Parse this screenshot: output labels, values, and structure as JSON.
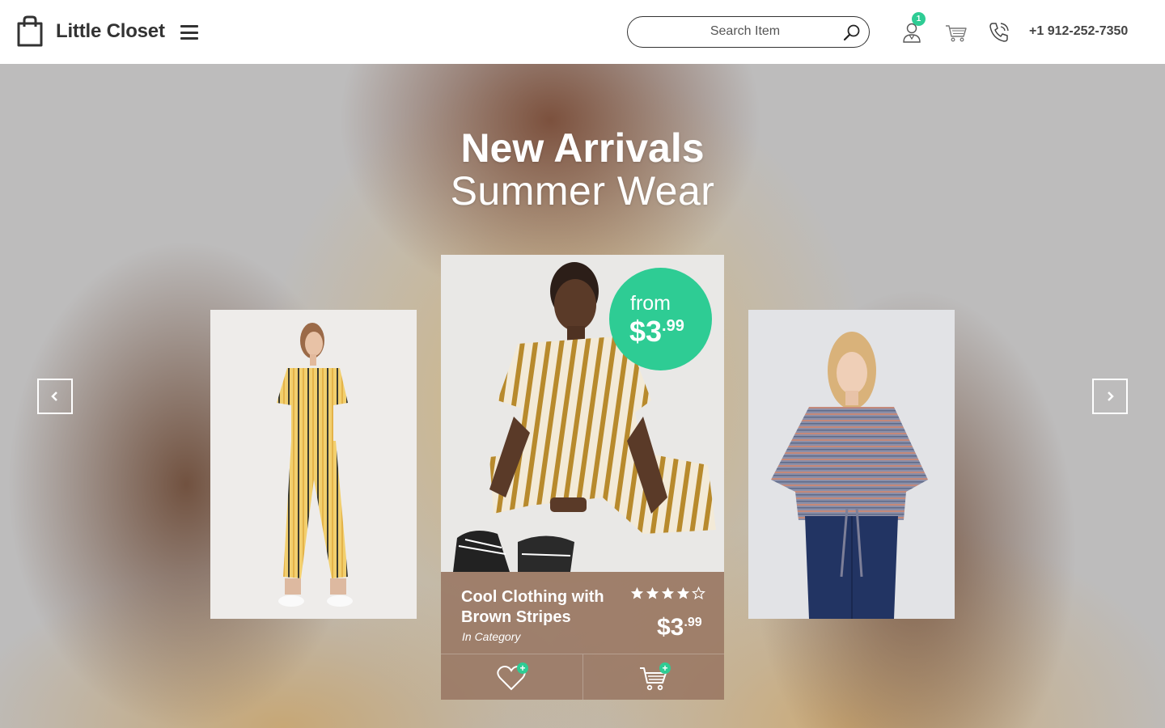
{
  "brand": {
    "name": "Little Closet"
  },
  "header": {
    "search": {
      "placeholder": "Search Item"
    },
    "account": {
      "badge_count": "1"
    },
    "phone": "+1 912-252-7350"
  },
  "hero": {
    "title": "New Arrivals",
    "subtitle": "Summer Wear"
  },
  "featured_product": {
    "name": "Cool Clothing with Brown Stripes",
    "category": "In Category",
    "rating": 4,
    "rating_max": 5,
    "price_main": "$3",
    "price_cents": ".99",
    "badge": {
      "from_label": "from",
      "price_main": "$3",
      "price_cents": ".99"
    }
  },
  "colors": {
    "accent": "#2ecc94",
    "text_dark": "#333333"
  },
  "icons": {
    "logo": "shopping-bag-icon",
    "menu": "hamburger-menu-icon",
    "search": "magnifier-icon",
    "account": "user-icon",
    "cart": "cart-icon",
    "phone": "phone-icon",
    "wishlist": "heart-icon",
    "add_to_cart": "cart-icon",
    "prev": "chevron-left-icon",
    "next": "chevron-right-icon"
  }
}
